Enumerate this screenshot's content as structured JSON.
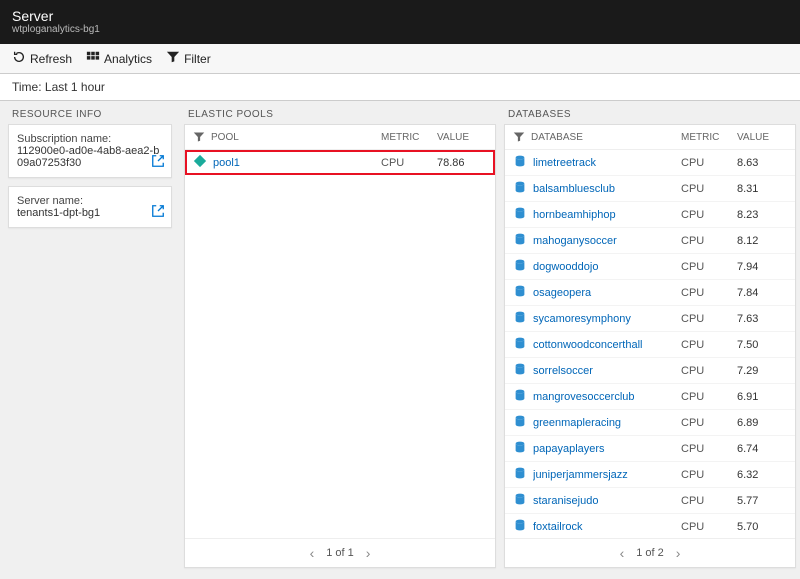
{
  "header": {
    "title": "Server",
    "subtitle": "wtploganalytics-bg1"
  },
  "toolbar": {
    "refresh": "Refresh",
    "analytics": "Analytics",
    "filter": "Filter"
  },
  "timebar": {
    "label": "Time: Last 1 hour"
  },
  "resourceInfo": {
    "label": "RESOURCE INFO",
    "subscription": {
      "label": "Subscription name:",
      "value": "112900e0-ad0e-4ab8-aea2-b09a07253f30"
    },
    "server": {
      "label": "Server name:",
      "value": "tenants1-dpt-bg1"
    }
  },
  "elasticPools": {
    "label": "ELASTIC POOLS",
    "headers": {
      "name": "POOL",
      "metric": "METRIC",
      "value": "VALUE"
    },
    "rows": [
      {
        "name": "pool1",
        "metric": "CPU",
        "value": "78.86"
      }
    ],
    "pager": "1 of 1"
  },
  "databases": {
    "label": "DATABASES",
    "headers": {
      "name": "DATABASE",
      "metric": "METRIC",
      "value": "VALUE"
    },
    "rows": [
      {
        "name": "limetreetrack",
        "metric": "CPU",
        "value": "8.63"
      },
      {
        "name": "balsambluesclub",
        "metric": "CPU",
        "value": "8.31"
      },
      {
        "name": "hornbeamhiphop",
        "metric": "CPU",
        "value": "8.23"
      },
      {
        "name": "mahoganysoccer",
        "metric": "CPU",
        "value": "8.12"
      },
      {
        "name": "dogwooddojo",
        "metric": "CPU",
        "value": "7.94"
      },
      {
        "name": "osageopera",
        "metric": "CPU",
        "value": "7.84"
      },
      {
        "name": "sycamoresymphony",
        "metric": "CPU",
        "value": "7.63"
      },
      {
        "name": "cottonwoodconcerthall",
        "metric": "CPU",
        "value": "7.50"
      },
      {
        "name": "sorrelsoccer",
        "metric": "CPU",
        "value": "7.29"
      },
      {
        "name": "mangrovesoccerclub",
        "metric": "CPU",
        "value": "6.91"
      },
      {
        "name": "greenmapleracing",
        "metric": "CPU",
        "value": "6.89"
      },
      {
        "name": "papayaplayers",
        "metric": "CPU",
        "value": "6.74"
      },
      {
        "name": "juniperjammersjazz",
        "metric": "CPU",
        "value": "6.32"
      },
      {
        "name": "staranisejudo",
        "metric": "CPU",
        "value": "5.77"
      },
      {
        "name": "foxtailrock",
        "metric": "CPU",
        "value": "5.70"
      }
    ],
    "pager": "1 of 2"
  }
}
